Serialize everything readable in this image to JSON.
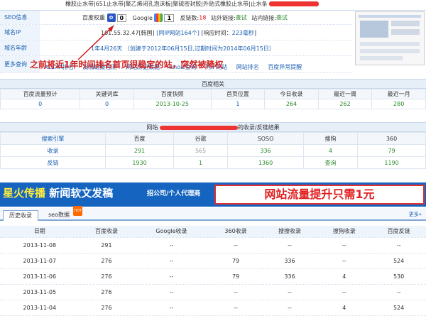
{
  "top_line": "橡胶止水带|651止水带|聚乙烯闭孔泡沫板|聚硫密封胶|外贴式橡胶止水带|止水条",
  "seo": {
    "label": "SEO信息",
    "baidu_weight_label": "百度权重",
    "baidu_weight": "0",
    "google_label": "Google",
    "google_pr": "1",
    "backlinks_label": "反链数:",
    "backlinks": "18",
    "external_links_label": "站外链接:",
    "external_links": "查试",
    "internal_links_label": "站内链接:",
    "internal_links": "查试"
  },
  "ip": {
    "label": "域名IP",
    "value": "101.55.32.47[韩国]",
    "same_ip": "[同IP网站164个]",
    "response_label": "[响应时间：",
    "response_value": "223毫秒",
    "response_close": "]"
  },
  "age": {
    "label": "域名年龄",
    "value": "1年4月26天",
    "detail": "（创建于2012年06月15日,过期时间为2014年06月15日）"
  },
  "more": {
    "label": "更多查询",
    "items": [
      "ALEXA排名",
      "友情链接检测",
      "网站历史数据",
      "whois查询",
      "同IP网站",
      "网站排名",
      "百度异常提醒"
    ]
  },
  "overlay_text": "之前将近1年时间排名首页很稳定的站，突然被降权",
  "baidu_section": {
    "title": "百度相关",
    "headers": [
      "百度流量预计",
      "关键词库",
      "百度快照",
      "首页位置",
      "今日收录",
      "最近一周",
      "最近一月"
    ],
    "values": [
      "0",
      "0",
      "2013-10-25",
      "1",
      "264",
      "262",
      "280"
    ]
  },
  "index_section": {
    "title_prefix": "网站",
    "title_suffix": "的收录/反链结果",
    "headers": [
      "搜索引擎",
      "百度",
      "谷歌",
      "SOSO",
      "搜狗",
      "360"
    ],
    "rows": [
      {
        "label": "收录",
        "values": [
          "291",
          "565",
          "336",
          "4",
          "79"
        ]
      },
      {
        "label": "反链",
        "values": [
          "1930",
          "1",
          "1360",
          "查询",
          "1190"
        ]
      }
    ]
  },
  "banner": {
    "left": "星火传播",
    "left2": "新闻软文发稿",
    "mid": "招公司/个人代理商",
    "right": "网站流量提升只需1元"
  },
  "tabs": {
    "items": [
      "历史收录",
      "seo数据"
    ],
    "hot": "HOT",
    "more": "更多»"
  },
  "history": {
    "headers": [
      "日期",
      "百度收录",
      "Google收录",
      "360收录",
      "搜搜收录",
      "搜狗收录",
      "百度反链"
    ],
    "rows": [
      [
        "2013-11-08",
        "291",
        "--",
        "--",
        "--",
        "--",
        "--"
      ],
      [
        "2013-11-07",
        "276",
        "--",
        "79",
        "336",
        "--",
        "524"
      ],
      [
        "2013-11-06",
        "276",
        "--",
        "79",
        "336",
        "4",
        "530"
      ],
      [
        "2013-11-05",
        "276",
        "--",
        "--",
        "--",
        "--",
        "--"
      ],
      [
        "2013-11-04",
        "276",
        "--",
        "--",
        "--",
        "4",
        "524"
      ]
    ]
  },
  "colors": {
    "accent": "#1b5fb0",
    "alert": "#d11111",
    "banner": "#1565c0"
  }
}
